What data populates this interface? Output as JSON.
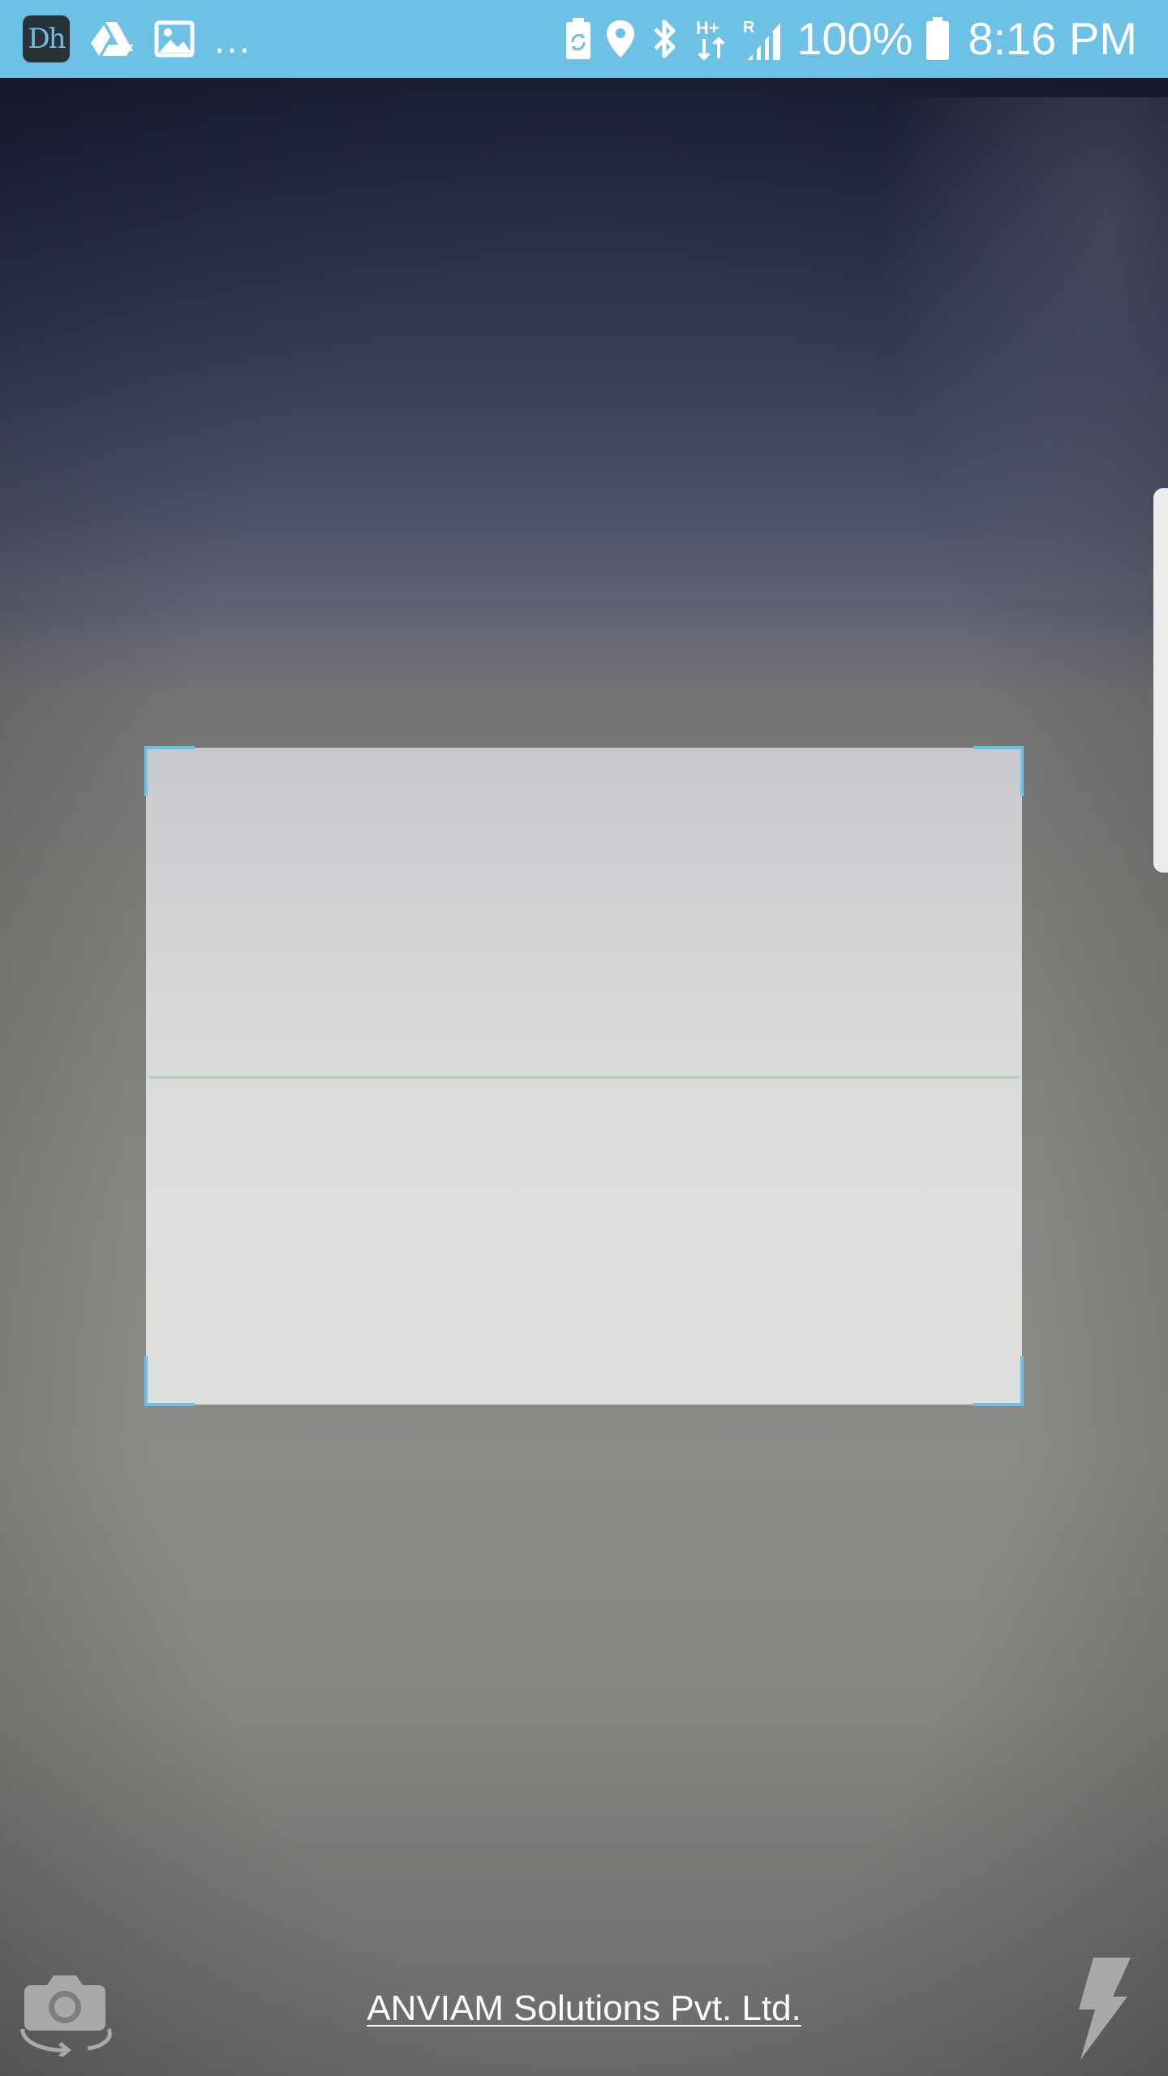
{
  "status_bar": {
    "app_badge_text": "Dh",
    "overflow": "...",
    "battery_percent": "100%",
    "time": "8:16 PM",
    "network_type": "H+",
    "roaming": "R",
    "background_color": "#6cc1e5",
    "icons_left": [
      "app-notification-icon",
      "drive-icon",
      "image-icon",
      "overflow-ellipsis"
    ],
    "icons_right": [
      "battery-saver-icon",
      "location-icon",
      "bluetooth-icon",
      "network-hplus-icon",
      "signal-roaming-icon",
      "battery-icon"
    ]
  },
  "scanner": {
    "accent_color": "#6cc1e5",
    "scan_line_color": "#a8d2a9"
  },
  "controls": {
    "switch_camera_icon": "switch-camera-icon",
    "flash_icon": "flash-icon"
  },
  "footer": {
    "company": "ANVIAM Solutions Pvt. Ltd."
  }
}
